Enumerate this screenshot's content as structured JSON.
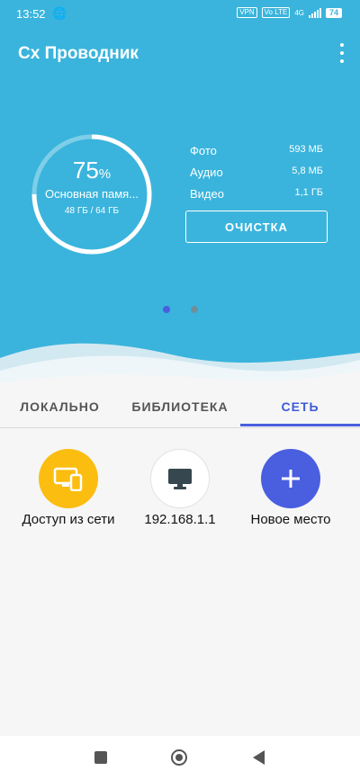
{
  "status_bar": {
    "time": "13:52",
    "vpn": "VPN",
    "volte": "Vo LTE",
    "network": "4G",
    "battery": "74"
  },
  "app": {
    "title": "Cx Проводник"
  },
  "storage": {
    "percent": "75",
    "percent_sign": "%",
    "percent_value": 0.75,
    "name": "Основная памя...",
    "size": "48 ГБ / 64 ГБ",
    "stats": [
      {
        "label": "Фото",
        "value": "593 МБ"
      },
      {
        "label": "Аудио",
        "value": "5,8 МБ"
      },
      {
        "label": "Видео",
        "value": "1,1 ГБ"
      }
    ],
    "clean_label": "ОЧИСТКА"
  },
  "pager": {
    "active_index": 0,
    "count": 2
  },
  "tabs": [
    {
      "label": "ЛОКАЛЬНО",
      "active": false
    },
    {
      "label": "БИБЛИОТЕКА",
      "active": false
    },
    {
      "label": "СЕТЬ",
      "active": true
    }
  ],
  "network_items": [
    {
      "label": "Доступ из сети",
      "icon": "devices-icon",
      "color": "#fbbd10"
    },
    {
      "label": "192.168.1.1",
      "icon": "monitor-icon",
      "color": "#ffffff"
    },
    {
      "label": "Новое место",
      "icon": "plus-icon",
      "color": "#4a5ee0"
    }
  ],
  "colors": {
    "primary": "#3ab4dc",
    "accent": "#4a5ee0"
  }
}
